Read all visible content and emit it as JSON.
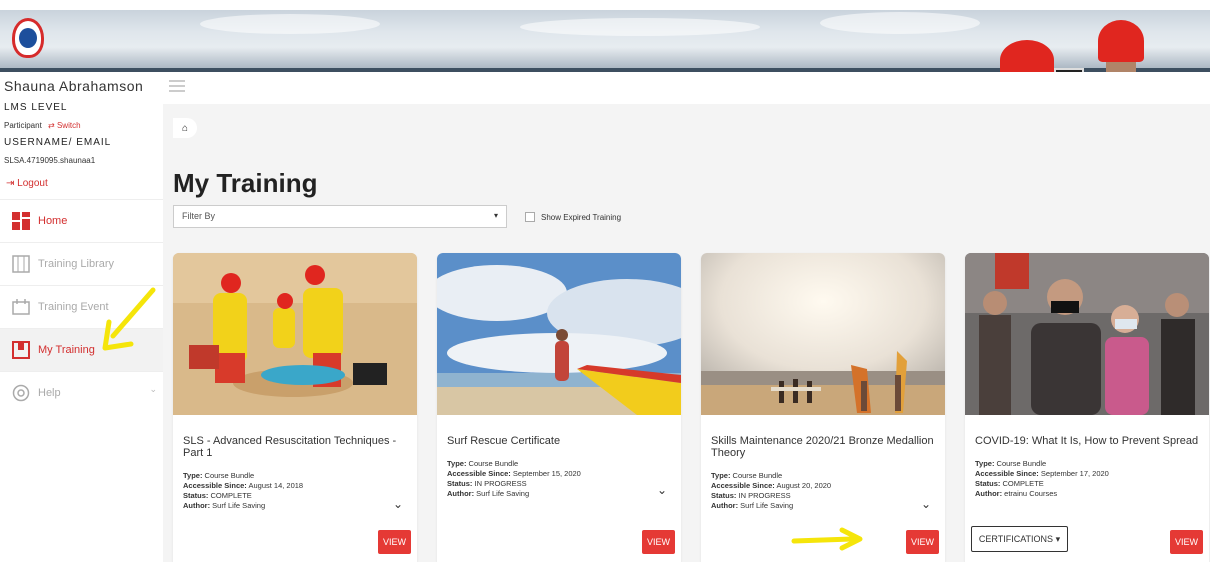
{
  "user": {
    "name": "Shauna Abrahamson",
    "level_label": "LMS LEVEL",
    "participant": "Participant",
    "switch": "Switch",
    "username_label": "USERNAME/ EMAIL",
    "username_value": "SLSA.4719095.shaunaa1",
    "logout": "Logout"
  },
  "nav": [
    {
      "label": "Home",
      "icon": "home-icon"
    },
    {
      "label": "Training Library",
      "icon": "library-icon"
    },
    {
      "label": "Training Event",
      "icon": "event-icon"
    },
    {
      "label": "My Training",
      "icon": "my-training-icon"
    },
    {
      "label": "Help",
      "icon": "help-icon"
    }
  ],
  "main": {
    "breadcrumb_icon": "home-icon",
    "title": "My Training",
    "filter_placeholder": "Filter By",
    "show_expired_label": "Show Expired Training"
  },
  "cards": [
    {
      "title": "SLS - Advanced Resuscitation Techniques - Part 1",
      "type_label": "Type:",
      "type": "Course Bundle",
      "since_label": "Accessible Since:",
      "since": "August 14, 2018",
      "status_label": "Status:",
      "status": "COMPLETE",
      "author_label": "Author:",
      "author": "Surf Life Saving",
      "view": "VIEW"
    },
    {
      "title": "Surf Rescue Certificate",
      "type_label": "Type:",
      "type": "Course Bundle",
      "since_label": "Accessible Since:",
      "since": "September 15, 2020",
      "status_label": "Status:",
      "status": "IN PROGRESS",
      "author_label": "Author:",
      "author": "Surf Life Saving",
      "view": "VIEW"
    },
    {
      "title": "Skills Maintenance 2020/21 Bronze Medallion Theory",
      "type_label": "Type:",
      "type": "Course Bundle",
      "since_label": "Accessible Since:",
      "since": "August 20, 2020",
      "status_label": "Status:",
      "status": "IN PROGRESS",
      "author_label": "Author:",
      "author": "Surf Life Saving",
      "view": "VIEW"
    },
    {
      "title": "COVID-19: What It Is, How to Prevent Spread",
      "type_label": "Type:",
      "type": "Course Bundle",
      "since_label": "Accessible Since:",
      "since": "September 17, 2020",
      "status_label": "Status:",
      "status": "COMPLETE",
      "author_label": "Author:",
      "author": "etrainu Courses",
      "certifications": "CERTIFICATIONS",
      "view": "VIEW"
    }
  ],
  "colors": {
    "accent": "#e53935",
    "annotation": "#f5e50a"
  }
}
